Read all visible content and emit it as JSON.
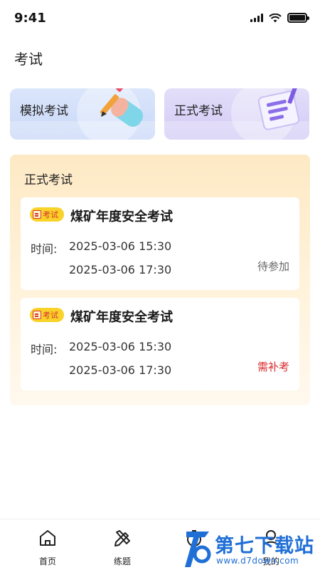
{
  "status_bar": {
    "time": "9:41"
  },
  "page_title": "考试",
  "mode_cards": [
    {
      "label": "模拟考试",
      "icon": "pencil-eraser-icon"
    },
    {
      "label": "正式考试",
      "icon": "document-scroll-icon"
    }
  ],
  "formal_section": {
    "title": "正式考试",
    "exams": [
      {
        "badge": "考试",
        "name": "煤矿年度安全考试",
        "time_label": "时间:",
        "start": "2025-03-06 15:30",
        "end": "2025-03-06 17:30",
        "status": "待参加",
        "status_color": "#666666"
      },
      {
        "badge": "考试",
        "name": "煤矿年度安全考试",
        "time_label": "时间:",
        "start": "2025-03-06 15:30",
        "end": "2025-03-06 17:30",
        "status": "需补考",
        "status_color": "#d92b2b"
      }
    ]
  },
  "tab_bar": {
    "home": "首页",
    "practice": "练题",
    "mine": "我的"
  },
  "watermark": {
    "title": "第七下载站",
    "url": "www.d7down.com"
  },
  "colors": {
    "badge_bg": "#f9d32a",
    "section_bg": "#fde9c4",
    "watermark": "#1f6fd6"
  }
}
